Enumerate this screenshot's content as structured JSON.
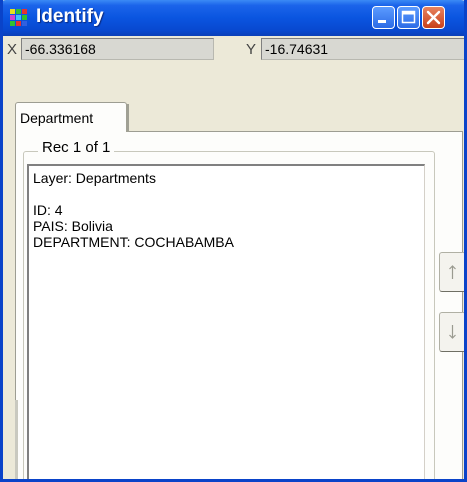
{
  "window": {
    "title": "Identify"
  },
  "coords": {
    "x_label": "X",
    "x_value": "-66.336168",
    "y_label": "Y",
    "y_value": "-16.74631"
  },
  "tabs": [
    {
      "label": "Department"
    }
  ],
  "record": {
    "group_label": "Rec 1 of 1",
    "lines": [
      "Layer: Departments",
      "",
      "ID: 4",
      "PAIS: Bolivia",
      "DEPARTMENT: COCHABAMBA"
    ]
  },
  "icons": {
    "app": "colored-grid-icon",
    "minimize": "minimize-icon",
    "maximize": "maximize-icon",
    "close": "close-icon",
    "prev": "arrow-up-icon",
    "next": "arrow-down-icon"
  }
}
